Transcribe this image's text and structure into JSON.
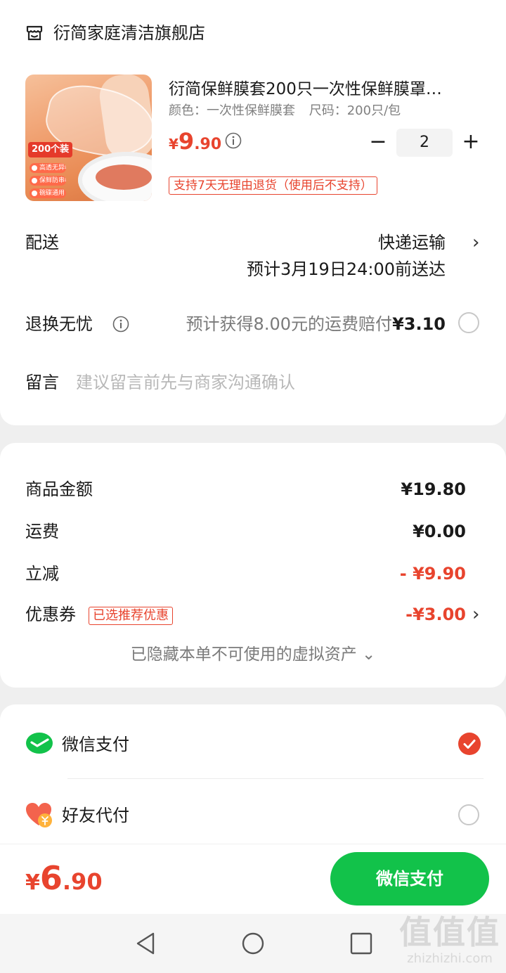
{
  "store": {
    "name": "衍简家庭清洁旗舰店",
    "icon": "store-icon"
  },
  "product": {
    "title": "衍简保鲜膜套200只一次性保鲜膜罩…",
    "spec_color": "颜色：一次性保鲜膜套",
    "spec_size": "尺码：200只/包",
    "price_yen": "¥",
    "price_int": "9",
    "price_dec": ".90",
    "quantity": "2",
    "minus": "−",
    "plus": "+",
    "return_badge": "支持7天无理由退货（使用后不支持）",
    "image": {
      "pack_label": "200个装",
      "chips": [
        "高透无异味",
        "保鲜防串味",
        "碗碟通用"
      ]
    }
  },
  "delivery": {
    "label": "配送",
    "method": "快递运输",
    "eta": "预计3月19日24:00前送达"
  },
  "return_insurance": {
    "label": "退换无忧",
    "text": "预计获得8.00元的运费赔付",
    "amount": "¥3.10"
  },
  "message": {
    "label": "留言",
    "placeholder": "建议留言前先与商家沟通确认"
  },
  "summary": {
    "goods_label": "商品金额",
    "goods_value": "¥19.80",
    "shipping_label": "运费",
    "shipping_value": "¥0.00",
    "discount_label": "立减",
    "discount_value": "- ¥9.90",
    "coupon_label": "优惠券",
    "coupon_badge": "已选推荐优惠",
    "coupon_value": "-¥3.00",
    "hidden_assets": "已隐藏本单不可使用的虚拟资产 ⌄"
  },
  "payment": {
    "wechat_label": "微信支付",
    "friend_label": "好友代付",
    "selected": "wechat"
  },
  "footer": {
    "total_yen": "¥",
    "total_int": "6",
    "total_dec": ".90",
    "pay_button": "微信支付"
  },
  "watermark": {
    "big": "值值值",
    "small": "zhizhizhi.com"
  },
  "colors": {
    "accent": "#e8442e",
    "wechat_green": "#12c24a",
    "muted": "#7a7a7a"
  }
}
